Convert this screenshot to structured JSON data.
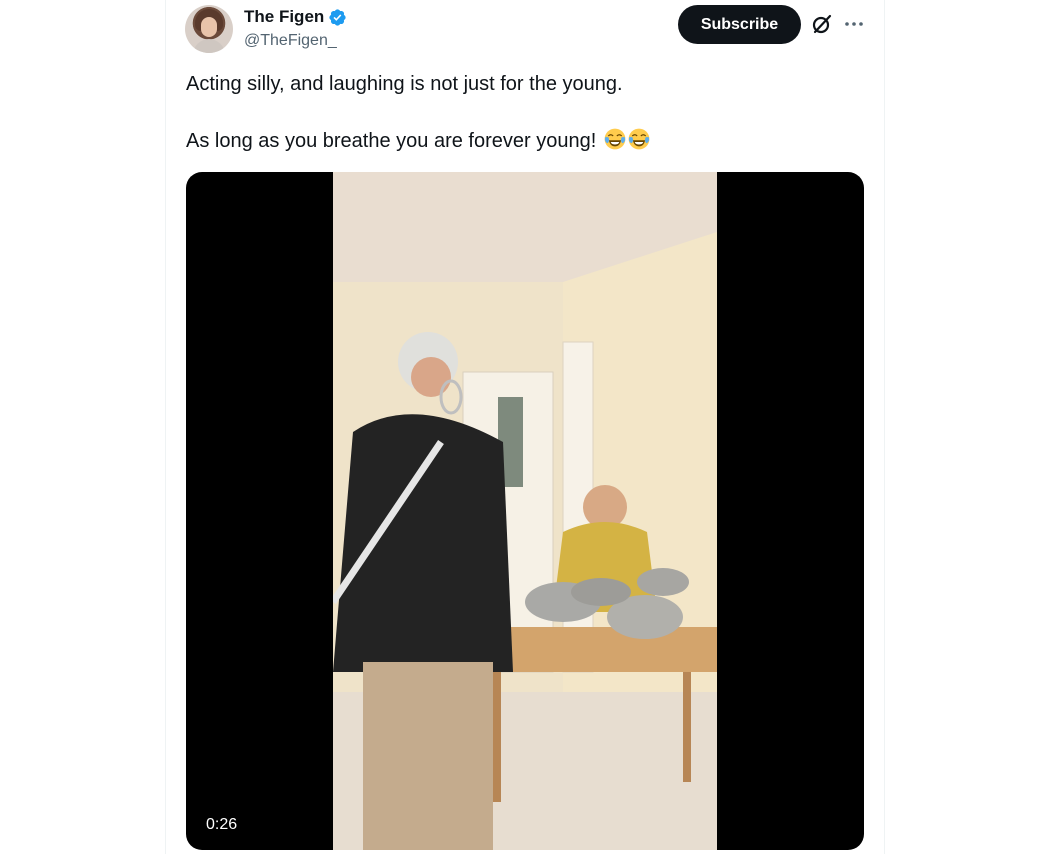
{
  "post": {
    "author": {
      "display_name": "The Figen",
      "handle": "@TheFigen_",
      "verified": true
    },
    "subscribe_label": "Subscribe",
    "text_lines": [
      "Acting silly, and laughing is not just for the young.",
      "As long as you breathe you are forever young!"
    ],
    "text_emoji": [
      "face-with-tears-of-joy",
      "face-with-tears-of-joy"
    ],
    "media": {
      "type": "video",
      "duration": "0:26"
    }
  },
  "icons": {
    "verified": "verified-badge-icon",
    "grok": "grok-icon",
    "more": "more-icon"
  },
  "colors": {
    "text_primary": "#0f1419",
    "text_secondary": "#536471",
    "verified_blue": "#1d9bf0",
    "button_dark": "#0f1419",
    "media_background": "#000000"
  }
}
